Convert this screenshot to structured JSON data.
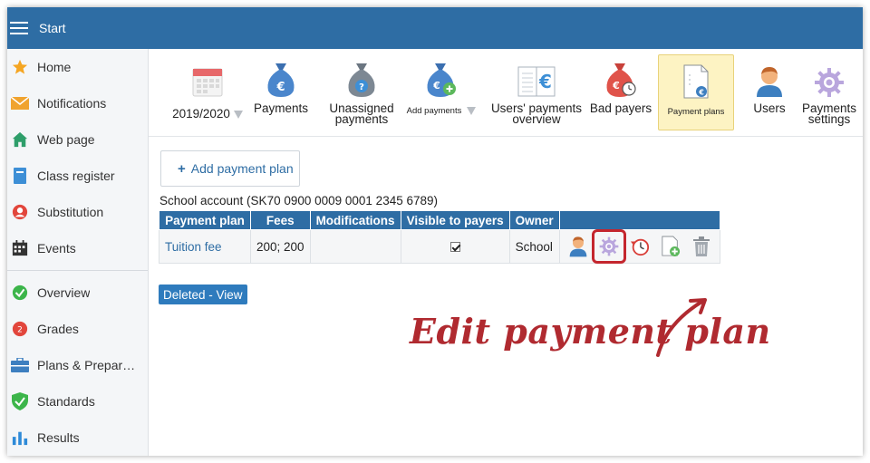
{
  "topbar": {
    "title": "Start"
  },
  "sidebar": {
    "items": [
      {
        "label": "Home",
        "icon": "star-icon",
        "color": "#f5a623"
      },
      {
        "label": "Notifications",
        "icon": "envelope-icon",
        "color": "#f0a32e"
      },
      {
        "label": "Web page",
        "icon": "house-icon",
        "color": "#2e9e6a"
      },
      {
        "label": "Class register",
        "icon": "book-icon",
        "color": "#3d8fd6"
      },
      {
        "label": "Substitution",
        "icon": "person-swap-icon",
        "color": "#e2463c"
      },
      {
        "label": "Events",
        "icon": "calendar-icon",
        "color": "#333333"
      }
    ],
    "items2": [
      {
        "label": "Overview",
        "icon": "check-circle-icon",
        "color": "#3cb54a"
      },
      {
        "label": "Grades",
        "icon": "grades-icon",
        "color": "#e2463c"
      },
      {
        "label": "Plans & Prepar…",
        "icon": "briefcase-icon",
        "color": "#3d7fc0"
      },
      {
        "label": "Standards",
        "icon": "shield-check-icon",
        "color": "#3cb54a"
      },
      {
        "label": "Results",
        "icon": "bar-chart-icon",
        "color": "#2e8ad8"
      }
    ]
  },
  "toolbar": {
    "year": {
      "label": "2019/2020",
      "icon": "calendar-icon"
    },
    "payments": {
      "label": "Payments",
      "icon": "money-bag-euro-icon"
    },
    "unassigned": {
      "label": "Unassigned payments",
      "icon": "money-bag-question-icon"
    },
    "add_payments": {
      "label": "Add payments",
      "icon": "money-bag-add-icon"
    },
    "users_overview": {
      "label": "Users' payments overview",
      "icon": "ledger-euro-icon"
    },
    "bad_payers": {
      "label": "Bad payers",
      "icon": "money-bag-clock-icon"
    },
    "payment_plans": {
      "label": "Payment plans",
      "icon": "document-euro-icon"
    },
    "users": {
      "label": "Users",
      "icon": "user-icon"
    },
    "settings": {
      "label": "Payments settings",
      "icon": "gear-icon"
    }
  },
  "add_plan_button": {
    "label": "Add payment plan"
  },
  "account_text": "School account (SK70 0900 0009 0001 2345 6789)",
  "table": {
    "headers": [
      "Payment plan",
      "Fees",
      "Modifications",
      "Visible to payers",
      "Owner",
      ""
    ],
    "rows": [
      {
        "plan": "Tuition fee",
        "fees": "200; 200",
        "modifications": "",
        "visible": true,
        "owner": "School"
      }
    ]
  },
  "deleted_button": {
    "label": "Deleted - View"
  },
  "annotation": {
    "text": "Edit payment plan",
    "color": "#b02a30"
  }
}
